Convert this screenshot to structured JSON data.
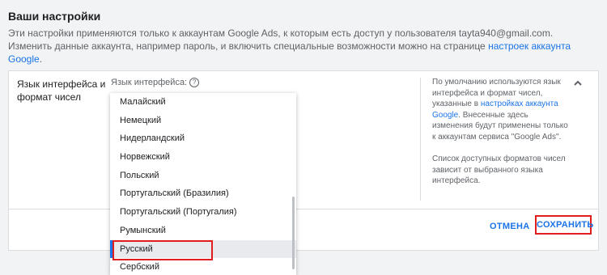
{
  "header": {
    "title": "Ваши настройки",
    "desc_part1": "Эти настройки применяются только к аккаунтам Google Ads, к которым есть доступ у пользователя tayta940@gmail.com. Изменить данные аккаунта, например пароль, и включить специальные возможности можно на странице ",
    "desc_link": "настроек аккаунта Google",
    "desc_part2": "."
  },
  "card": {
    "section_label": "Язык интерфейса и формат чисел",
    "field_label": "Язык интерфейса:",
    "help_icon": "?",
    "help_text_1a": "По умолчанию используются язык интерфейса и формат чисел, указанные в ",
    "help_link": "настройках аккаунта Google",
    "help_text_1b": ". Внесенные здесь изменения будут применены только к аккаунтам сервиса \"Google Ads\".",
    "help_text_2": "Список доступных форматов чисел зависит от выбранного языка интерфейса.",
    "cancel_label": "ОТМЕНА",
    "save_label": "СОХРАНИТЬ"
  },
  "dropdown": {
    "options": [
      "Малайский",
      "Немецкий",
      "Нидерландский",
      "Норвежский",
      "Польский",
      "Португальский (Бразилия)",
      "Португальский (Португалия)",
      "Румынский",
      "Русский",
      "Сербский"
    ],
    "selected": "Русский"
  },
  "colors": {
    "accent": "#1a73e8",
    "highlight_border": "#e01e1e"
  }
}
